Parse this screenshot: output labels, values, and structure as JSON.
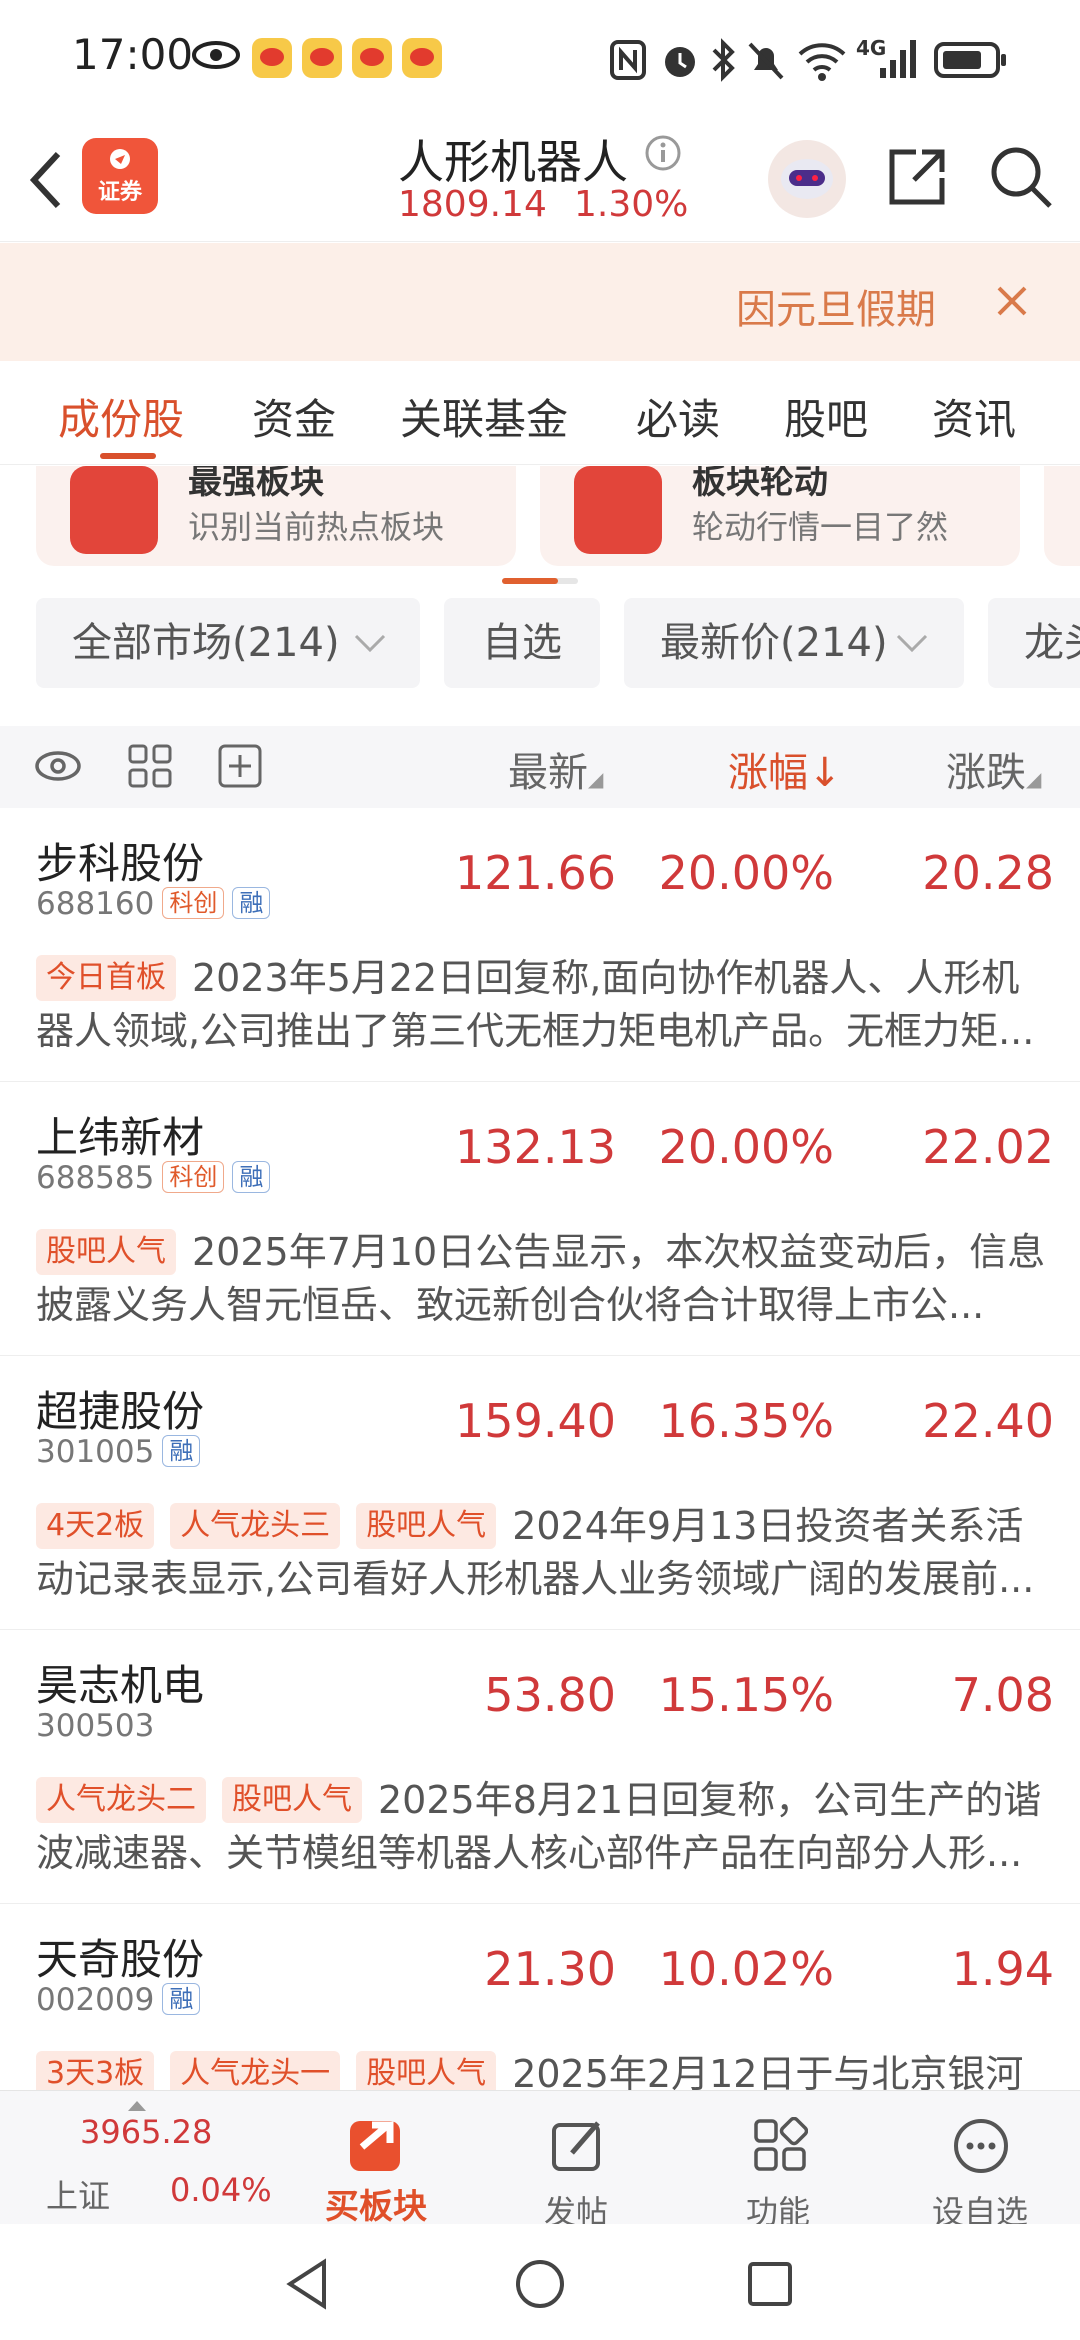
{
  "status_bar": {
    "time": "17:00",
    "network": "4G"
  },
  "header": {
    "back_icon": "chevron-left-icon",
    "app_badge": "证券",
    "title": "人形机器人",
    "index_value": "1809.14",
    "index_change": "1.30%",
    "colors": {
      "up": "#d0393a",
      "accent": "#d9502c"
    }
  },
  "notice": {
    "text": "因元旦假期"
  },
  "tabs": [
    "成份股",
    "资金",
    "关联基金",
    "必读",
    "股吧",
    "资讯"
  ],
  "cards": [
    {
      "title": "最强板块",
      "subtitle": "识别当前热点板块"
    },
    {
      "title": "板块轮动",
      "subtitle": "轮动行情一目了然"
    }
  ],
  "filters": {
    "market": "全部市场(214)",
    "watchlist": "自选",
    "price": "最新价(214)",
    "leader": "龙头"
  },
  "columns": {
    "latest": "最新",
    "change_pct": "涨幅",
    "change": "涨跌"
  },
  "stocks": [
    {
      "name": "步科股份",
      "code": "688160",
      "kc": "科创",
      "rong": "融",
      "price": "121.66",
      "pct": "20.00%",
      "chg": "20.28",
      "tags": [
        "今日首板"
      ],
      "desc": "2023年5月22日回复称,面向协作机器人、人形机器人领域,公司推出了第三代无框力矩电机产品。无框力矩..."
    },
    {
      "name": "上纬新材",
      "code": "688585",
      "kc": "科创",
      "rong": "融",
      "price": "132.13",
      "pct": "20.00%",
      "chg": "22.02",
      "tags": [
        "股吧人气"
      ],
      "desc": "2025年7月10日公告显示，本次权益变动后，信息披露义务人智元恒岳、致远新创合伙将合计取得上市公..."
    },
    {
      "name": "超捷股份",
      "code": "301005",
      "kc": "",
      "rong": "融",
      "price": "159.40",
      "pct": "16.35%",
      "chg": "22.40",
      "tags": [
        "4天2板",
        "人气龙头三",
        "股吧人气"
      ],
      "desc": "2024年9月13日投资者关系活动记录表显示,公司看好人形机器人业务领域广阔的发展前..."
    },
    {
      "name": "昊志机电",
      "code": "300503",
      "kc": "",
      "rong": "",
      "price": "53.80",
      "pct": "15.15%",
      "chg": "7.08",
      "tags": [
        "人气龙头二",
        "股吧人气"
      ],
      "desc": "2025年8月21日回复称，公司生产的谐波减速器、关节模组等机器人核心部件产品在向部分人形..."
    },
    {
      "name": "天奇股份",
      "code": "002009",
      "kc": "",
      "rong": "融",
      "price": "21.30",
      "pct": "10.02%",
      "chg": "1.94",
      "tags": [
        "3天3板",
        "人气龙头一",
        "股吧人气"
      ],
      "desc": "2025年2月12日于与北京银河"
    }
  ],
  "bottom_bar": {
    "index_value": "3965.28",
    "index_name": "上证",
    "index_pct": "0.04%",
    "items": [
      "买板块",
      "发帖",
      "功能",
      "设自选"
    ]
  }
}
